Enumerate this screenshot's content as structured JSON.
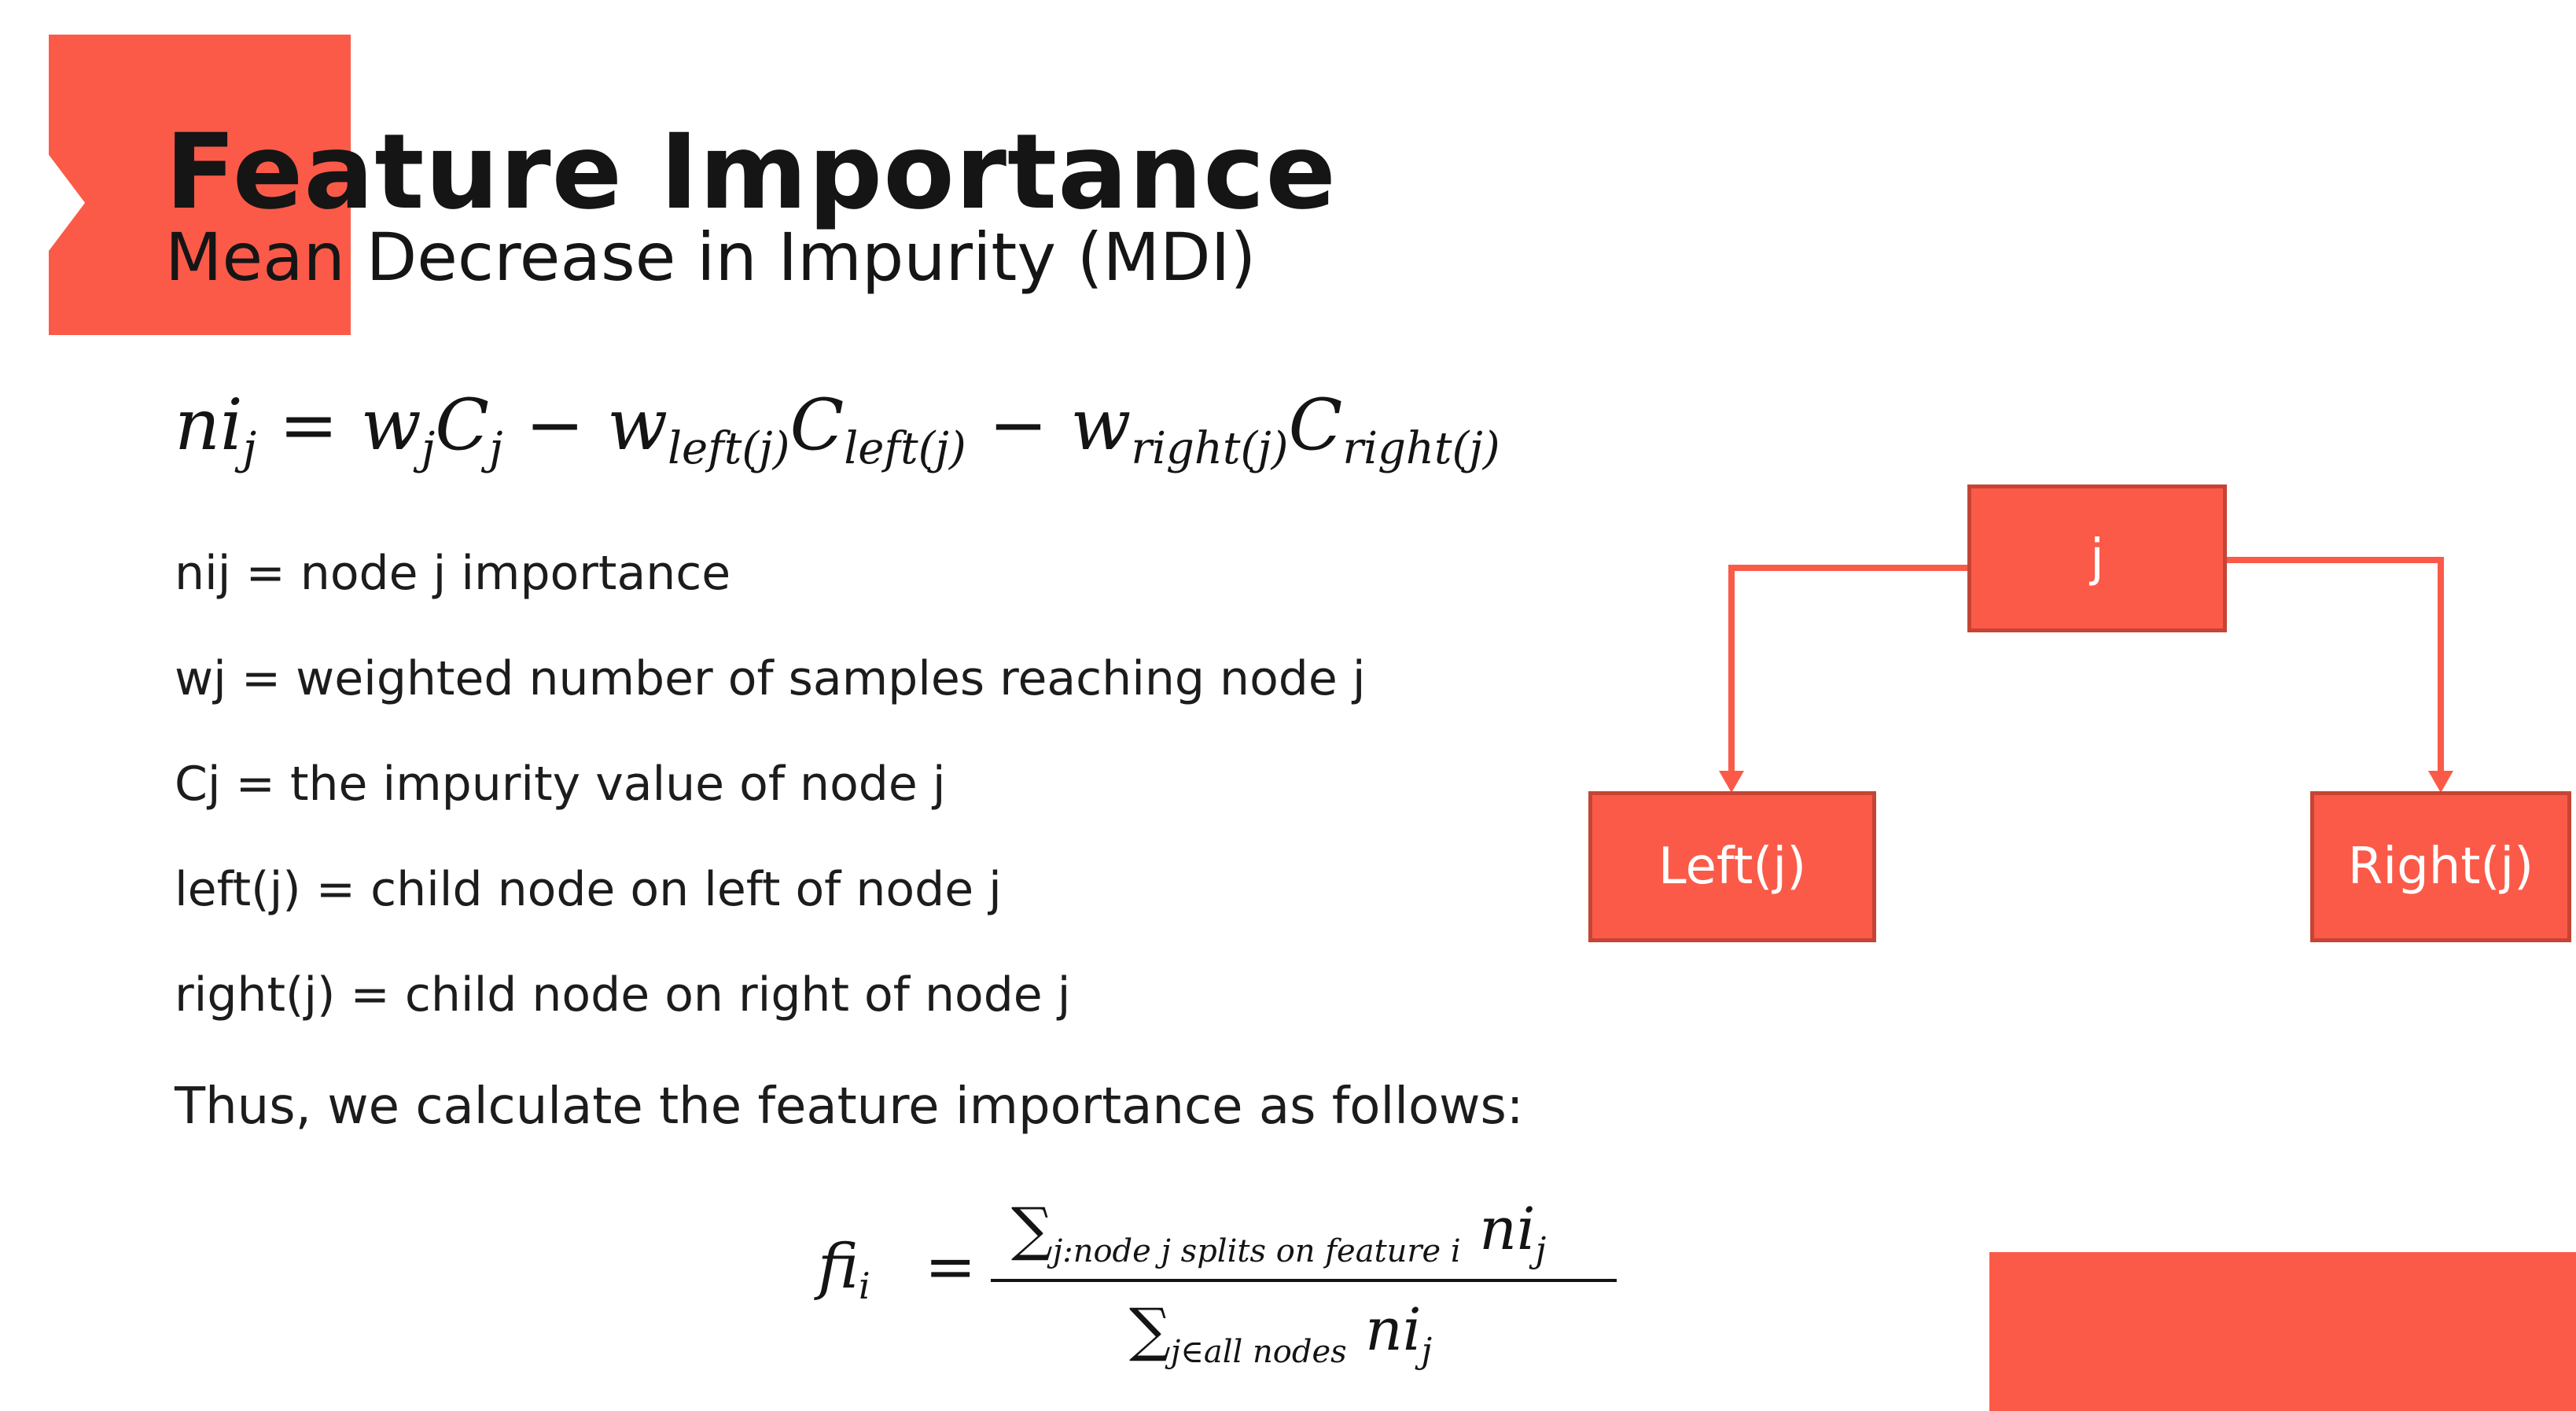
{
  "slide": {
    "title": "Feature Importance",
    "subtitle": "Mean Decrease in Impurity (MDI)",
    "node_formula": {
      "lhs": "ni",
      "lhs_sub": "j",
      "eq": "=",
      "t1": "w",
      "t1_sub": "j",
      "t2": "C",
      "t2_sub": "j",
      "minus1": "−",
      "t3": "w",
      "t3_sub": "left(j)",
      "t4": "C",
      "t4_sub": "left(j)",
      "minus2": "−",
      "t5": "w",
      "t5_sub": "right(j)",
      "t6": "C",
      "t6_sub": "right(j)"
    },
    "definitions": [
      "nij = node j importance",
      "wj = weighted number of samples reaching node j",
      "Cj = the impurity value of node j",
      "left(j) = child node on left of node j",
      "right(j) = child node on right of node j"
    ],
    "conclusion": "Thus, we calculate the feature importance as follows:",
    "fi_formula": {
      "lhs": "fi",
      "lhs_sub": "i",
      "eq": "=",
      "sum": "∑",
      "num_sub": "j:node j splits on feature i",
      "num_term": "ni",
      "num_term_sub": "j",
      "den_sub": "j∈all nodes",
      "den_term": "ni",
      "den_term_sub": "j"
    },
    "tree": {
      "root": "j",
      "left": "Left(j)",
      "right": "Right(j)"
    },
    "colors": {
      "accent": "#fb5a49",
      "node_border": "#c64434",
      "text": "#1c1c1c"
    }
  }
}
